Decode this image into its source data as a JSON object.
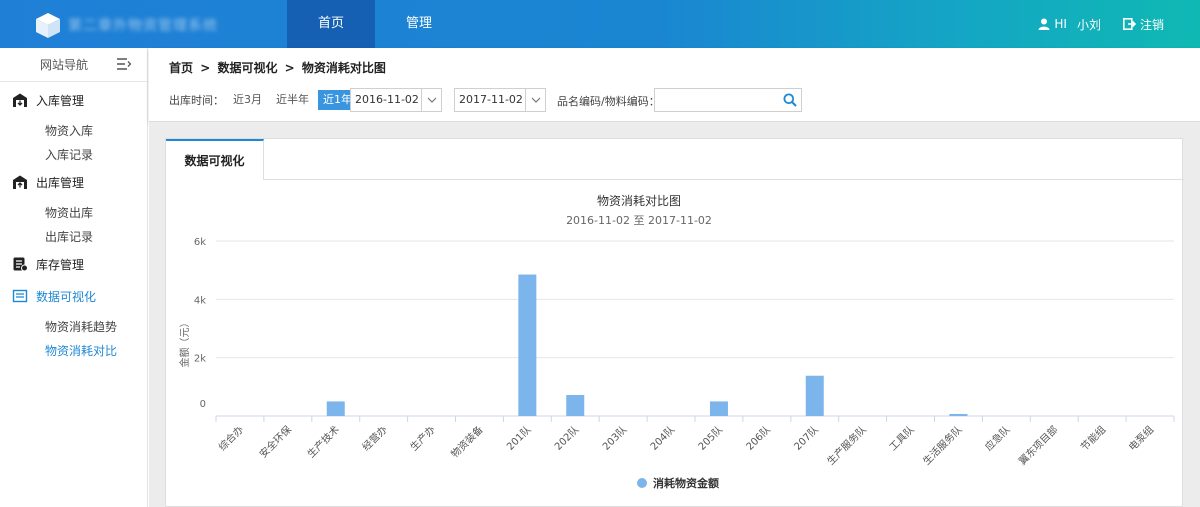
{
  "app": {
    "brand": "第二章外物资管理系统"
  },
  "nav": {
    "tabs": [
      {
        "label": "首页"
      },
      {
        "label": "管理"
      }
    ]
  },
  "user": {
    "greeting": "HI",
    "name": "小刘",
    "logout": "注销"
  },
  "sidebar": {
    "title": "网站导航",
    "groups": [
      {
        "label": "入库管理",
        "icon": "warehouse-in-icon",
        "items": [
          "物资入库",
          "入库记录"
        ]
      },
      {
        "label": "出库管理",
        "icon": "warehouse-out-icon",
        "items": [
          "物资出库",
          "出库记录"
        ]
      },
      {
        "label": "库存管理",
        "icon": "inventory-icon",
        "items": []
      },
      {
        "label": "数据可视化",
        "icon": "chart-icon",
        "items": [
          "物资消耗趋势",
          "物资消耗对比"
        ]
      }
    ]
  },
  "breadcrumb": {
    "home": "首页",
    "sep": ">",
    "section": "数据可视化",
    "page": "物资消耗对比图"
  },
  "filter": {
    "label": "出库时间：",
    "ranges": [
      "近3月",
      "近半年",
      "近1年"
    ],
    "active_range": "近1年",
    "start_date": "2016-11-02",
    "end_date": "2017-11-02",
    "code_label": "品名编码/物料编码：",
    "code_value": ""
  },
  "panel": {
    "tab": "数据可视化"
  },
  "colors": {
    "bar": "#7cb5ec",
    "accent": "#1e88d6"
  },
  "chart_data": {
    "type": "bar",
    "title": "物资消耗对比图",
    "subtitle": "2016-11-02 至 2017-11-02",
    "ylabel": "金额（元）",
    "xlabel": "",
    "ylim": [
      0,
      6000
    ],
    "yticks": [
      0,
      2000,
      4000,
      6000
    ],
    "ytick_labels": [
      "0",
      "2k",
      "4k",
      "6k"
    ],
    "grid": true,
    "legend_position": "bottom-center",
    "categories": [
      "综合办",
      "安全环保",
      "生产技术",
      "经营办",
      "生产办",
      "物资装备",
      "201队",
      "202队",
      "203队",
      "204队",
      "205队",
      "206队",
      "207队",
      "生产服务队",
      "工具队",
      "生活服务队",
      "应急队",
      "翼东项目部",
      "节能组",
      "电泵组"
    ],
    "series": [
      {
        "name": "消耗物资金额",
        "values": [
          0,
          0,
          500,
          0,
          0,
          0,
          4850,
          720,
          0,
          0,
          500,
          0,
          1380,
          0,
          0,
          70,
          0,
          0,
          0,
          0
        ]
      }
    ]
  }
}
